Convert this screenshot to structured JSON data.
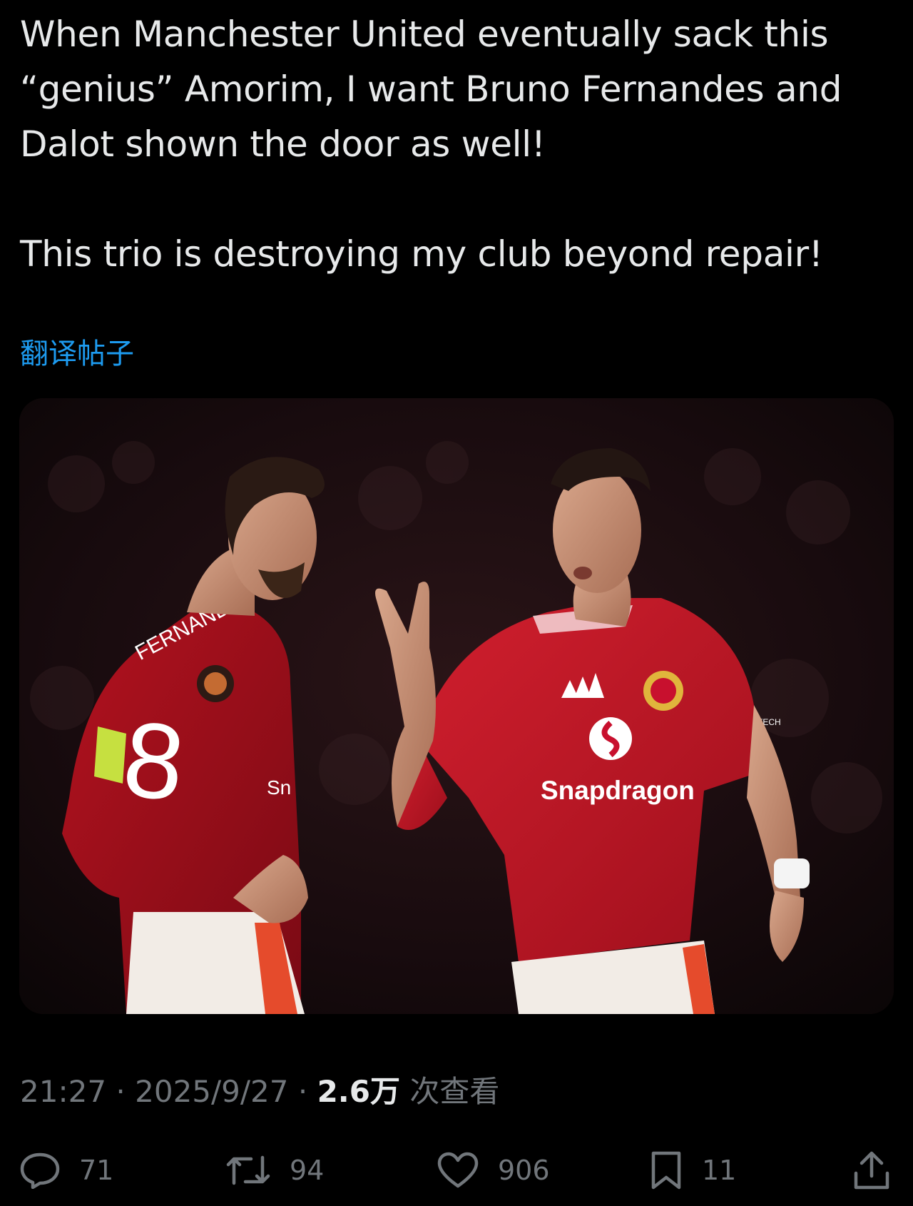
{
  "tweet": {
    "lines": [
      "When Manchester United eventually sack this",
      "“genius” Amorim, I want Bruno Fernandes and",
      "Dalot shown the door as well!"
    ],
    "line2": "This trio is destroying my club beyond repair!",
    "translate_label": "翻译帖子"
  },
  "media": {
    "left_player_name": "FERNANDES",
    "left_player_number": "8",
    "sponsor_text": "Snapdragon",
    "sleeve_text": "TECH",
    "sleeve_partial": "Sn"
  },
  "meta": {
    "time": "21:27",
    "date": "2025/9/27",
    "separator": "·",
    "views_count": "2.6万",
    "views_label": "次查看"
  },
  "actions": {
    "replies": "71",
    "reposts": "94",
    "likes": "906",
    "bookmarks": "11"
  },
  "colors": {
    "background": "#000000",
    "text": "#e7e9ea",
    "muted": "#71767b",
    "link": "#1d9bf0",
    "jersey_red": "#c8102e"
  },
  "icons": [
    "reply-icon",
    "repost-icon",
    "like-icon",
    "bookmark-icon",
    "share-icon"
  ]
}
